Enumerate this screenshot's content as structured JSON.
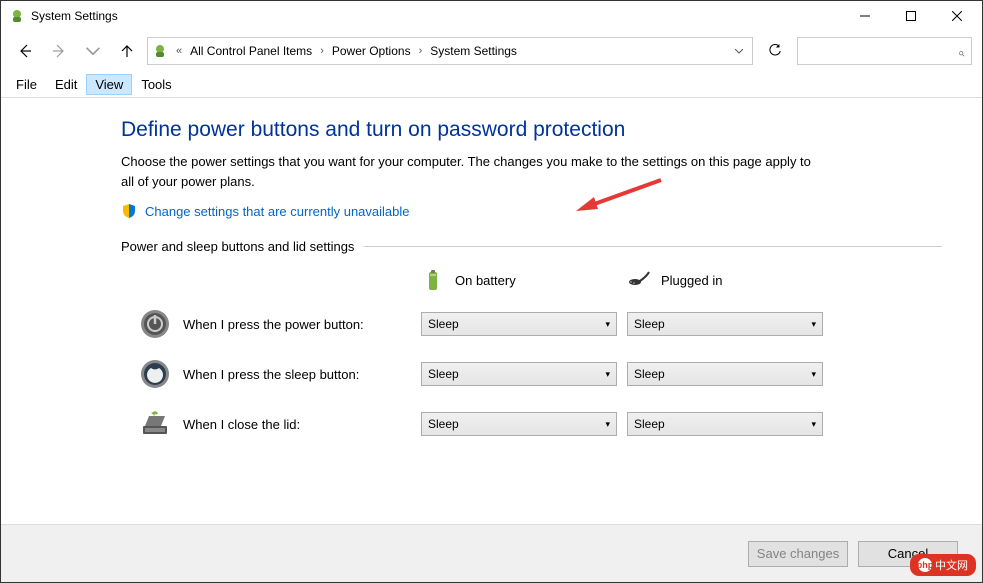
{
  "window": {
    "title": "System Settings"
  },
  "breadcrumb": {
    "prefix": "«",
    "items": [
      "All Control Panel Items",
      "Power Options",
      "System Settings"
    ]
  },
  "menubar": [
    "File",
    "Edit",
    "View",
    "Tools"
  ],
  "menubar_active_index": 2,
  "page": {
    "title": "Define power buttons and turn on password protection",
    "description": "Choose the power settings that you want for your computer. The changes you make to the settings on this page apply to all of your power plans.",
    "change_link": "Change settings that are currently unavailable",
    "section_label": "Power and sleep buttons and lid settings",
    "columns": {
      "battery": "On battery",
      "plugged": "Plugged in"
    },
    "rows": [
      {
        "label": "When I press the power button:",
        "battery": "Sleep",
        "plugged": "Sleep"
      },
      {
        "label": "When I press the sleep button:",
        "battery": "Sleep",
        "plugged": "Sleep"
      },
      {
        "label": "When I close the lid:",
        "battery": "Sleep",
        "plugged": "Sleep"
      }
    ]
  },
  "footer": {
    "save": "Save changes",
    "cancel": "Cancel"
  },
  "watermark": "中文网"
}
